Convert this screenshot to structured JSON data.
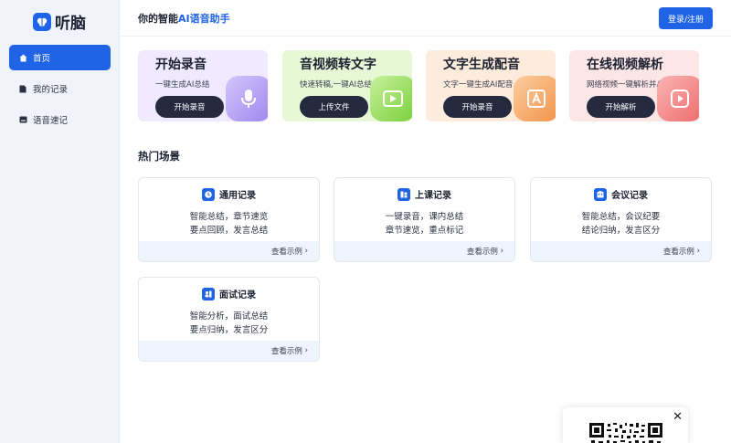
{
  "app": {
    "logo_text": "听脑"
  },
  "sidebar": {
    "items": [
      {
        "label": "首页",
        "icon": "home-icon",
        "active": true
      },
      {
        "label": "我的记录",
        "icon": "document-icon",
        "active": false
      },
      {
        "label": "语音速记",
        "icon": "keyboard-icon",
        "active": false
      }
    ]
  },
  "header": {
    "title_prefix": "你的智能",
    "title_ai": "AI语音助手",
    "login_label": "登录/注册"
  },
  "features": [
    {
      "title": "开始录音",
      "subtitle": "一键生成AI总结",
      "button": "开始录音",
      "icon": "microphone-icon",
      "bg": "#efeafe",
      "art": "#b7a2f2"
    },
    {
      "title": "音视频转文字",
      "subtitle": "快速转稿,一键AI总结",
      "button": "上传文件",
      "icon": "video-file-icon",
      "bg": "#e7f8d6",
      "art": "#8fde4a"
    },
    {
      "title": "文字生成配音",
      "subtitle": "文字一键生成AI配音",
      "button": "开始录音",
      "icon": "text-audio-icon",
      "bg": "#fdebdc",
      "art": "#f7a55f"
    },
    {
      "title": "在线视频解析",
      "subtitle": "网络视频一键解析并AI总结",
      "button": "开始解析",
      "icon": "play-icon",
      "bg": "#fde6e6",
      "art": "#f48383"
    }
  ],
  "scenes": {
    "section_title": "热门场景",
    "view_label": "查看示例",
    "cards": [
      {
        "title": "通用记录",
        "line1": "智能总结，章节速览",
        "line2": "要点回顾，发言总结",
        "icon": "general-record-icon"
      },
      {
        "title": "上课记录",
        "line1": "一键录音，课内总结",
        "line2": "章节速览，重点标记",
        "icon": "class-record-icon"
      },
      {
        "title": "会议记录",
        "line1": "智能总结，会议纪要",
        "line2": "结论归纳，发言区分",
        "icon": "meeting-record-icon"
      },
      {
        "title": "面试记录",
        "line1": "智能分析，面试总结",
        "line2": "要点归纳，发言区分",
        "icon": "interview-record-icon"
      }
    ]
  },
  "colors": {
    "accent": "#1f63e6",
    "dark_button": "#252a3e"
  }
}
